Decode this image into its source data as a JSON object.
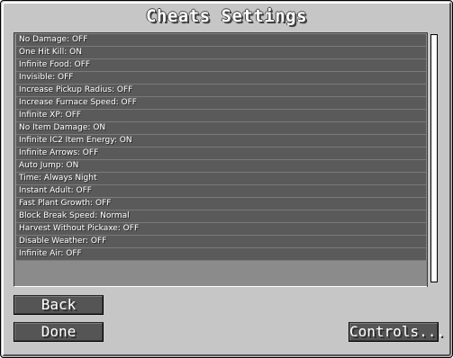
{
  "window": {
    "title": "Cheats Settings"
  },
  "cheats": [
    {
      "label": "No Damage: OFF"
    },
    {
      "label": "One Hit Kill: ON"
    },
    {
      "label": "Infinite Food: OFF"
    },
    {
      "label": "Invisible: OFF"
    },
    {
      "label": "Increase Pickup Radius: OFF"
    },
    {
      "label": "Increase Furnace Speed: OFF"
    },
    {
      "label": "Infinite XP: OFF"
    },
    {
      "label": "No Item Damage: ON"
    },
    {
      "label": "Infinite IC2 Item Energy: ON"
    },
    {
      "label": "Infinite Arrows: OFF"
    },
    {
      "label": "Auto Jump: ON"
    },
    {
      "label": "Time: Always Night"
    },
    {
      "label": "Instant Adult: OFF"
    },
    {
      "label": "Fast Plant Growth: OFF"
    },
    {
      "label": "Block Break Speed: Normal"
    },
    {
      "label": "Harvest Without Pickaxe: OFF"
    },
    {
      "label": "Disable Weather: OFF"
    },
    {
      "label": "Infinite Air: OFF"
    }
  ],
  "buttons": {
    "back": "Back",
    "done": "Done",
    "controls": "Controls..."
  },
  "colors": {
    "window_bg": "#c6c6c6",
    "list_bg": "#8b8b8b",
    "row_bg": "#5a5a5a",
    "button_bg": "#555555",
    "text": "#ffffff"
  }
}
